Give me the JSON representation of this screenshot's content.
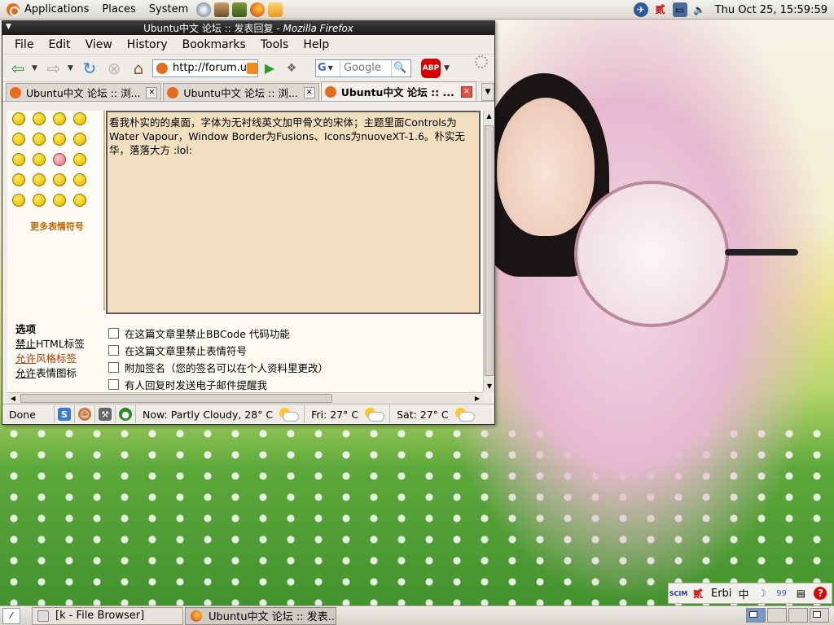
{
  "top_panel": {
    "menus": [
      "Applications",
      "Places",
      "System"
    ],
    "clock": "Thu Oct 25, 15:59:59"
  },
  "window": {
    "title_prefix": "Ubuntu中文 论坛 :: 发表回复 - ",
    "title_app": "Mozilla Firefox"
  },
  "menubar": {
    "items": [
      {
        "label": "File"
      },
      {
        "label": "Edit"
      },
      {
        "label": "View"
      },
      {
        "label": "History"
      },
      {
        "label": "Bookmarks"
      },
      {
        "label": "Tools"
      },
      {
        "label": "Help"
      }
    ]
  },
  "navbar": {
    "url": "http://forum.u",
    "search_placeholder": "Google",
    "search_engine": "G",
    "adblock_label": "ABP"
  },
  "tabs": [
    {
      "label": "Ubuntu中文 论坛 :: 浏..."
    },
    {
      "label": "Ubuntu中文 论坛 :: 浏..."
    },
    {
      "label": "Ubuntu中文 论坛 :: ..."
    }
  ],
  "editor": {
    "more_emoticons": "更多表情符号",
    "message": "看我朴实的的桌面，字体为无衬线英文加甲骨文的宋体；主题里面Controls为Water Vapour，Window Border为Fusions、Icons为nuoveXT-1.6。朴实无华，落落大方 :lol:"
  },
  "options": {
    "heading": "选项",
    "html_status": {
      "prefix": "禁止",
      "rest": "HTML标签"
    },
    "bbcode_status": {
      "prefix": "允许",
      "rest": "风格标签"
    },
    "smilies_status": {
      "prefix": "允许",
      "rest": "表情图标"
    },
    "checkboxes": [
      {
        "label": "在这篇文章里禁止BBCode 代码功能"
      },
      {
        "label": "在这篇文章里禁止表情符号"
      },
      {
        "label": "附加签名（您的签名可以在个人资料里更改）"
      },
      {
        "label": "有人回复时发送电子邮件提醒我"
      }
    ]
  },
  "statusbar": {
    "status": "Done",
    "weather_now": "Now: Partly Cloudy, 28° C",
    "weather_fri": "Fri: 27° C",
    "weather_sat": "Sat: 27° C"
  },
  "input_method": {
    "engine": "Erbi",
    "mode": "中",
    "brand": "SCIM",
    "punct": "99"
  },
  "taskbar": {
    "tasks": [
      {
        "label": "[k - File Browser]",
        "active": false
      },
      {
        "label": "Ubuntu中文 论坛 :: 发表...",
        "active": true
      }
    ]
  },
  "colors": {
    "ubuntu_orange": "#e56e1e",
    "link_alt": "#b03a00",
    "textarea_bg": "#f1dfc0"
  }
}
